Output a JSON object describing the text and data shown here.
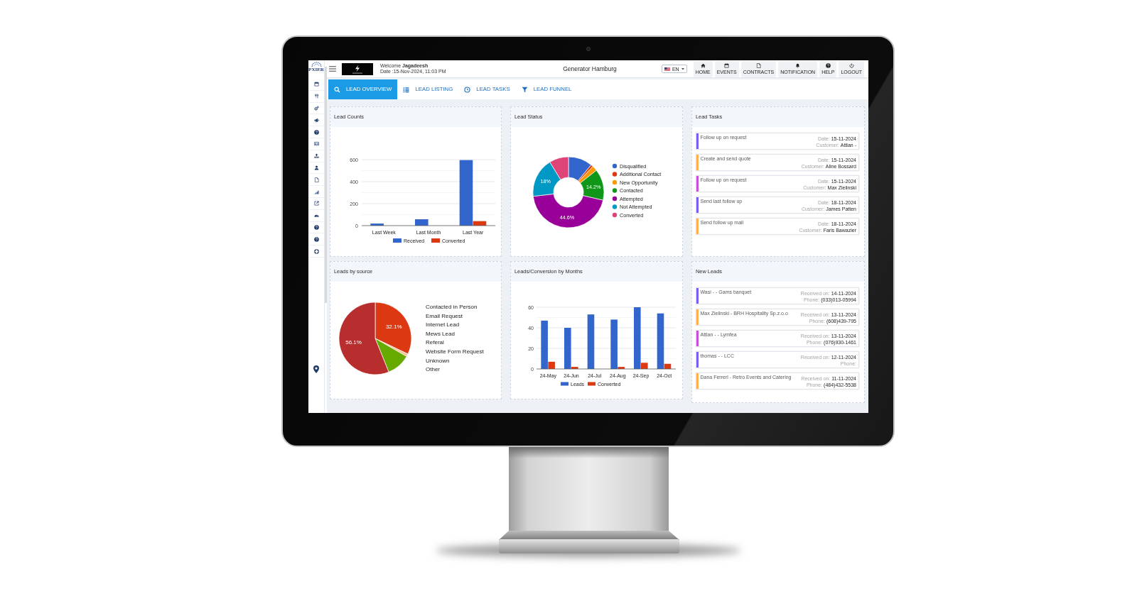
{
  "sidebar": {
    "logo_text": "PXIER"
  },
  "header": {
    "welcome": "Welcome **Jagadeesh**",
    "date": "Date :15-Nov-2024, 11:03 PM",
    "title": "Generator Hamburg",
    "language": "EN",
    "buttons": [
      "HOME",
      "EVENTS",
      "CONTRACTS",
      "NOTIFICATION",
      "HELP",
      "LOGOUT"
    ]
  },
  "tabs": [
    {
      "label": "LEAD OVERVIEW",
      "selected": true
    },
    {
      "label": "LEAD LISTING",
      "selected": false
    },
    {
      "label": "LEAD TASKS",
      "selected": false
    },
    {
      "label": "LEAD FUNNEL",
      "selected": false
    }
  ],
  "lead_counts": {
    "title": "Lead Counts",
    "chart_data": {
      "type": "bar",
      "categories": [
        "Last Week",
        "Last Month",
        "Last Year"
      ],
      "series": [
        {
          "name": "Received",
          "color": "#3366cc",
          "values": [
            19,
            58,
            596
          ]
        },
        {
          "name": "Converted",
          "color": "#dc3912",
          "values": [
            0,
            0,
            41
          ]
        }
      ],
      "ylim": [
        0,
        600
      ],
      "yticks": [
        0,
        200,
        400,
        600
      ],
      "legend": "bottom"
    }
  },
  "lead_status": {
    "title": "Lead Status",
    "chart_data": {
      "type": "donut",
      "categories": [
        "Disqualified",
        "Additional Contact",
        "New Opportunity",
        "Contacted",
        "Attempted",
        "Not Attempted",
        "Converted"
      ],
      "values": [
        11,
        1,
        2.4,
        14.2,
        44.6,
        18,
        8.8
      ],
      "colors": [
        "#3366cc",
        "#dc3912",
        "#ff9900",
        "#109618",
        "#990099",
        "#0099c6",
        "#dd4477"
      ],
      "value_labels": [
        null,
        null,
        null,
        "14.2%",
        "44.6%",
        "18%",
        null
      ],
      "legend": "right"
    }
  },
  "lead_tasks": {
    "title": "Lead Tasks",
    "items": [
      {
        "title": "Follow up on request",
        "date_label": "Date:",
        "date": "15-11-2024",
        "customer_label": "Customer:",
        "customer": "Attlan -",
        "color": "#7b5cf0"
      },
      {
        "title": "Create and send quote",
        "date_label": "Date:",
        "date": "15-11-2024",
        "customer_label": "Customer:",
        "customer": "Aline Bossard",
        "color": "#ffb04f"
      },
      {
        "title": "Follow up on request",
        "date_label": "Date:",
        "date": "15-11-2024",
        "customer_label": "Customer:",
        "customer": "Max Zielinski",
        "color": "#c54fd6"
      },
      {
        "title": "Send last follow up",
        "date_label": "Date:",
        "date": "18-11-2024",
        "customer_label": "Customer:",
        "customer": "James Patten",
        "color": "#7b5cf0"
      },
      {
        "title": "Send follow up mail",
        "date_label": "Date:",
        "date": "18-11-2024",
        "customer_label": "Customer:",
        "customer": "Faris Bawazier",
        "color": "#ffb04f"
      }
    ]
  },
  "leads_by_source": {
    "title": "Leads by source",
    "chart_data": {
      "type": "pie",
      "values": [
        32.1,
        1.2,
        10.6,
        56.1
      ],
      "colors": [
        "#dc3912",
        "#f6c29a",
        "#66aa00",
        "#b82e2e"
      ],
      "value_labels": [
        "32.1%",
        null,
        null,
        "56.1%"
      ]
    },
    "legend_labels": [
      "Contacted in Person",
      "Email Request",
      "Internet Lead",
      "Mews Lead",
      "Referal",
      "Website Form Request",
      "Unknown",
      "Other"
    ]
  },
  "leads_by_month": {
    "title": "Leads/Conversion by Months",
    "chart_data": {
      "type": "bar",
      "categories": [
        "24-May",
        "24-Jun",
        "24-Jul",
        "24-Aug",
        "24-Sep",
        "24-Oct"
      ],
      "series": [
        {
          "name": "Leads",
          "color": "#3366cc",
          "values": [
            47,
            40,
            53,
            48,
            60,
            54
          ]
        },
        {
          "name": "Converted",
          "color": "#dc3912",
          "values": [
            7,
            2,
            0,
            2,
            6,
            5
          ]
        }
      ],
      "ylim": [
        0,
        60
      ],
      "yticks": [
        0,
        20,
        40,
        60
      ],
      "legend": "bottom"
    }
  },
  "new_leads": {
    "title": "New Leads",
    "items": [
      {
        "title": "Wasi - - Gams banquet",
        "received_label": "Received on:",
        "received": "14-11-2024",
        "phone_label": "Phone:",
        "phone": "(033)013-05994",
        "color": "#7b5cf0"
      },
      {
        "title": "Max Zielinski - BRH Hospitality Sp.z.o.o",
        "received_label": "Received on:",
        "received": "13-11-2024",
        "phone_label": "Phone:",
        "phone": "(608)439-795",
        "color": "#ffb04f"
      },
      {
        "title": "Attlan - - Lymfea",
        "received_label": "Received on:",
        "received": "13-11-2024",
        "phone_label": "Phone:",
        "phone": "(076)930-1461",
        "color": "#c54fd6"
      },
      {
        "title": "thomas - - LCC",
        "received_label": "Received on:",
        "received": "12-11-2024",
        "phone_label": "Phone:",
        "color": "#7b5cf0"
      },
      {
        "title": "Dana Ferreri - Retro Events and Catering",
        "received_label": "Received on:",
        "received": "11-11-2024",
        "phone_label": "Phone:",
        "phone": "(484)432-5538",
        "color": "#ffb04f"
      }
    ]
  }
}
